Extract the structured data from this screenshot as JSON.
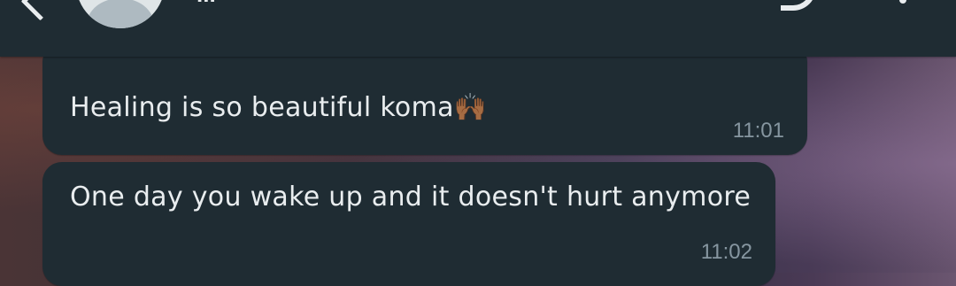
{
  "header": {
    "contact_name": "...",
    "back_icon": "back-arrow-icon",
    "call_icon": "call-icon",
    "menu_icon": "more-vertical-icon"
  },
  "messages": [
    {
      "text": "Healing is so beautiful koma",
      "emoji": "🙌🏾",
      "time": "11:01"
    },
    {
      "text": "One day you wake up and it doesn't hurt anymore",
      "emoji": "",
      "time": "11:02"
    }
  ],
  "colors": {
    "header_bg": "#1f2c33",
    "bubble_bg": "#1f2c33",
    "text": "#e9edef",
    "time": "#8696a0"
  }
}
